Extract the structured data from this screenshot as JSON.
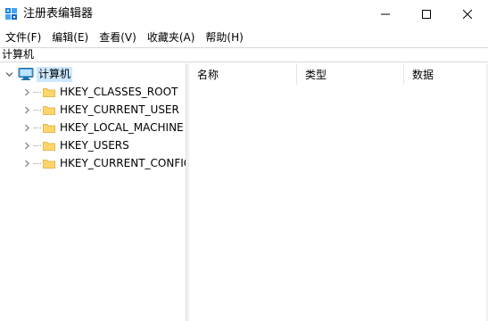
{
  "window": {
    "title": "注册表编辑器",
    "controls": {
      "minimize": "minimize",
      "maximize": "maximize",
      "close": "close"
    }
  },
  "menu": {
    "items": [
      {
        "label": "文件(F)"
      },
      {
        "label": "编辑(E)"
      },
      {
        "label": "查看(V)"
      },
      {
        "label": "收藏夹(A)"
      },
      {
        "label": "帮助(H)"
      }
    ]
  },
  "address": {
    "path": "计算机"
  },
  "tree": {
    "root": {
      "label": "计算机",
      "icon": "computer-icon",
      "expanded": true,
      "selected": true
    },
    "children": [
      {
        "label": "HKEY_CLASSES_ROOT",
        "icon": "folder-icon"
      },
      {
        "label": "HKEY_CURRENT_USER",
        "icon": "folder-icon"
      },
      {
        "label": "HKEY_LOCAL_MACHINE",
        "icon": "folder-icon"
      },
      {
        "label": "HKEY_USERS",
        "icon": "folder-icon"
      },
      {
        "label": "HKEY_CURRENT_CONFIG",
        "icon": "folder-icon"
      }
    ]
  },
  "list": {
    "columns": [
      {
        "label": "名称"
      },
      {
        "label": "类型"
      },
      {
        "label": "数据"
      }
    ],
    "rows": []
  },
  "colors": {
    "selection": "#cce8ff",
    "folder": "#ffd56a",
    "app_icon": "#1e88e5"
  }
}
